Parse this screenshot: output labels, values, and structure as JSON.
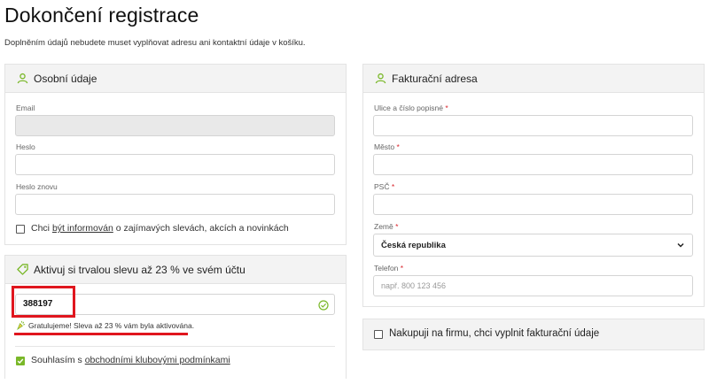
{
  "page": {
    "title": "Dokončení registrace",
    "subtitle": "Doplněním údajů nebudete muset vyplňovat adresu ani kontaktní údaje v košíku."
  },
  "personal": {
    "heading": "Osobní údaje",
    "email_label": "Email",
    "email_value": "",
    "password_label": "Heslo",
    "password_again_label": "Heslo znovu",
    "newsletter_prefix": "Chci ",
    "newsletter_link": "být informován",
    "newsletter_suffix": " o zajímavých slevách, akcích a novinkách"
  },
  "discount": {
    "heading": "Aktivuj si trvalou slevu až 23 % ve svém účtu",
    "code_value": "388197",
    "success_message": "Gratulujeme! Sleva až 23 % vám byla aktivována.",
    "terms_prefix": "Souhlasím s ",
    "terms_link": "obchodními klubovými podmínkami",
    "terms_checked": true
  },
  "billing": {
    "heading": "Fakturační adresa",
    "street_label": "Ulice a číslo popisné",
    "city_label": "Město",
    "zip_label": "PSČ",
    "country_label": "Země",
    "country_value": "Česká republika",
    "phone_label": "Telefon",
    "phone_placeholder": "např. 800 123 456",
    "required_mark": "*"
  },
  "company": {
    "label": "Nakupuji na firmu, chci vyplnit fakturační údaje"
  },
  "colors": {
    "accent_green": "#7ab829",
    "highlight_red": "#e0161e",
    "required_red": "#d9272e"
  },
  "icons": {
    "personal": "user-icon",
    "discount": "tag-icon",
    "billing": "user-icon",
    "valid": "check-circle-icon",
    "success": "confetti-icon",
    "dropdown": "chevron-down-icon"
  }
}
